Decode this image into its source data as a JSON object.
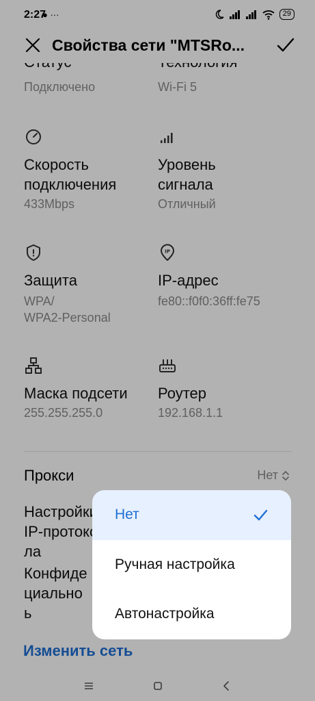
{
  "status_bar": {
    "time": "2:27",
    "left_icons": "● ···",
    "battery": "29",
    "icons": [
      "moon-icon",
      "signal-icon",
      "signal-icon",
      "wifi-icon",
      "battery-icon"
    ]
  },
  "header": {
    "title": "Свойства сети \"MTSRo..."
  },
  "details": {
    "status": {
      "label": "Статус",
      "value": "Подключено"
    },
    "technology": {
      "label": "Технология",
      "value": "Wi-Fi 5"
    },
    "speed": {
      "label_line1": "Скорость",
      "label_line2": "подключения",
      "value": "433Mbps",
      "icon": "speedometer-icon"
    },
    "signal": {
      "label_line1": "Уровень",
      "label_line2": "сигнала",
      "value": "Отличный",
      "icon": "signal-bars-icon"
    },
    "security": {
      "label": "Защита",
      "value_line1": "WPA/",
      "value_line2": "WPA2-Personal",
      "icon": "shield-icon"
    },
    "ip": {
      "label": "IP-адрес",
      "value": "fe80::f0f0:36ff:fe75",
      "icon": "ip-pin-icon"
    },
    "subnet": {
      "label": "Маска подсети",
      "value": "255.255.255.0",
      "icon": "network-icon"
    },
    "router": {
      "label": "Роутер",
      "value": "192.168.1.1",
      "icon": "router-icon"
    }
  },
  "proxy": {
    "label": "Прокси",
    "value": "Нет"
  },
  "behind_popup": {
    "line1": "Настройки",
    "line2": "IP-протоко",
    "line3": "ла",
    "line4": "Конфиде",
    "line5": "циально",
    "line6": "ь"
  },
  "change_network": "Изменить сеть",
  "popup": {
    "options": [
      {
        "label": "Нет",
        "selected": true
      },
      {
        "label": "Ручная настройка",
        "selected": false
      },
      {
        "label": "Автонастройка",
        "selected": false
      }
    ]
  },
  "colors": {
    "accent": "#1f6fd4",
    "selected_bg": "#e7f0ff",
    "secondary_text": "#8a8a8a"
  }
}
